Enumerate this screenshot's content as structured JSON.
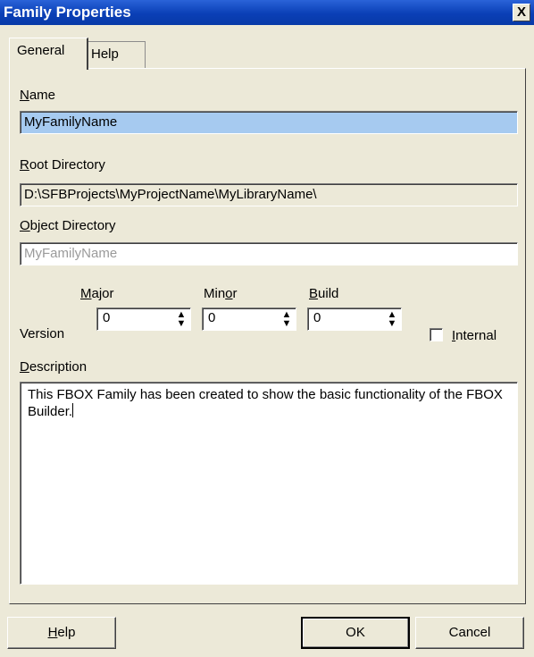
{
  "window": {
    "title": "Family Properties",
    "close_glyph": "X"
  },
  "tabs": {
    "general": "General",
    "help": "Help"
  },
  "name": {
    "label_key": "N",
    "label_rest": "ame",
    "value": "MyFamilyName"
  },
  "root_directory": {
    "label_key": "R",
    "label_rest": "oot Directory",
    "value": "D:\\SFBProjects\\MyProjectName\\MyLibraryName\\"
  },
  "object_directory": {
    "label_key": "O",
    "label_rest": "bject Directory",
    "value": "MyFamilyName"
  },
  "version": {
    "label": "Version",
    "major": {
      "label_pre": "",
      "label_key": "M",
      "label_rest": "ajor",
      "value": "0"
    },
    "minor": {
      "label_pre": "Min",
      "label_key": "o",
      "label_rest": "r",
      "value": "0"
    },
    "build": {
      "label_pre": "",
      "label_key": "B",
      "label_rest": "uild",
      "value": "0"
    },
    "spin_glyph_up": "▲",
    "spin_glyph_down": "▼"
  },
  "internal": {
    "label_key": "I",
    "label_rest": "nternal",
    "checked": false
  },
  "description": {
    "label_key": "D",
    "label_rest": "escription",
    "value": "This FBOX Family has been created to show the basic functionality of the FBOX Builder."
  },
  "buttons": {
    "help_key": "H",
    "help_rest": "elp",
    "ok": "OK",
    "cancel": "Cancel"
  }
}
